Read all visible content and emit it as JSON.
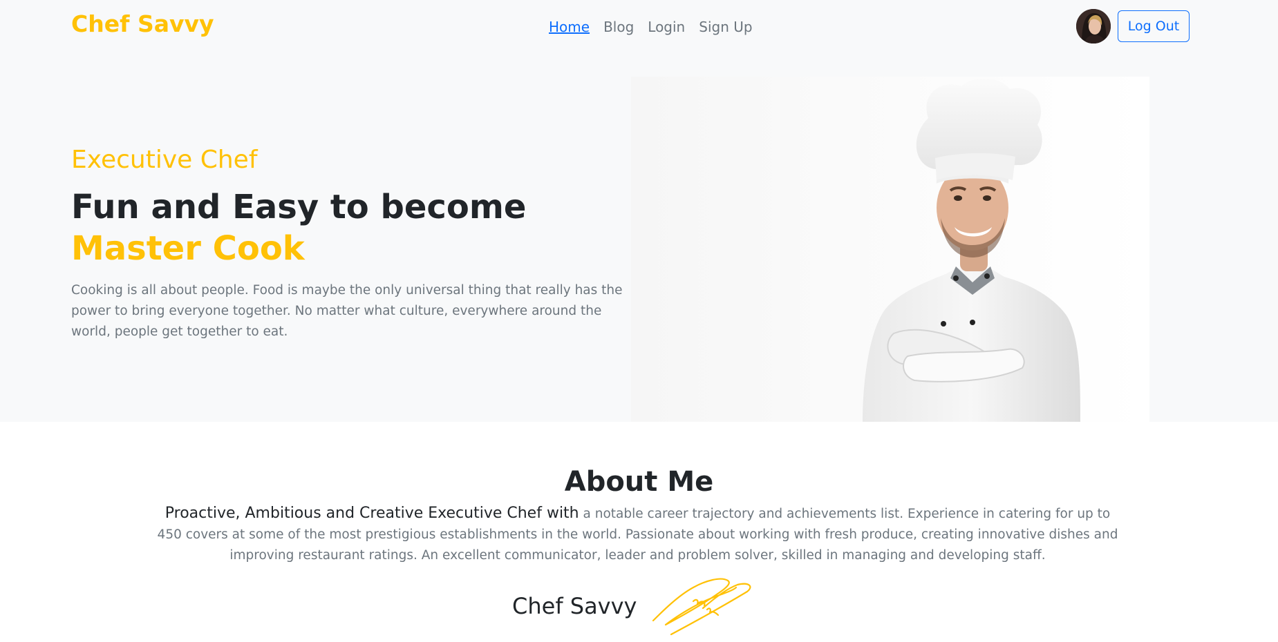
{
  "brand": "Chef Savvy",
  "nav": {
    "links": [
      "Home",
      "Blog",
      "Login",
      "Sign Up"
    ],
    "active": "Home",
    "logout_label": "Log Out"
  },
  "hero": {
    "eyebrow": "Executive Chef",
    "headline_main": "Fun and Easy to become ",
    "headline_accent": "Master Cook",
    "paragraph": "Cooking is all about people. Food is maybe the only universal thing that really has the power to bring everyone together. No matter what culture, everywhere around the world, people get together to eat."
  },
  "about": {
    "title": "About Me",
    "lead_strong": "Proactive, Ambitious and Creative Executive Chef with",
    "lead_rest": " a notable career trajectory and achievements list. Experience in catering for up to 450 covers at some of the most prestigious establishments in the world. Passionate about working with fresh produce, creating innovative dishes and improving restaurant ratings. An excellent communicator, leader and problem solver, skilled in managing and developing staff.",
    "signature_name": "Chef Savvy"
  },
  "colors": {
    "accent": "#ffc107",
    "link": "#0d6efd",
    "muted": "#6c757d",
    "text": "#212529",
    "hero_bg": "#f8f9fa"
  }
}
